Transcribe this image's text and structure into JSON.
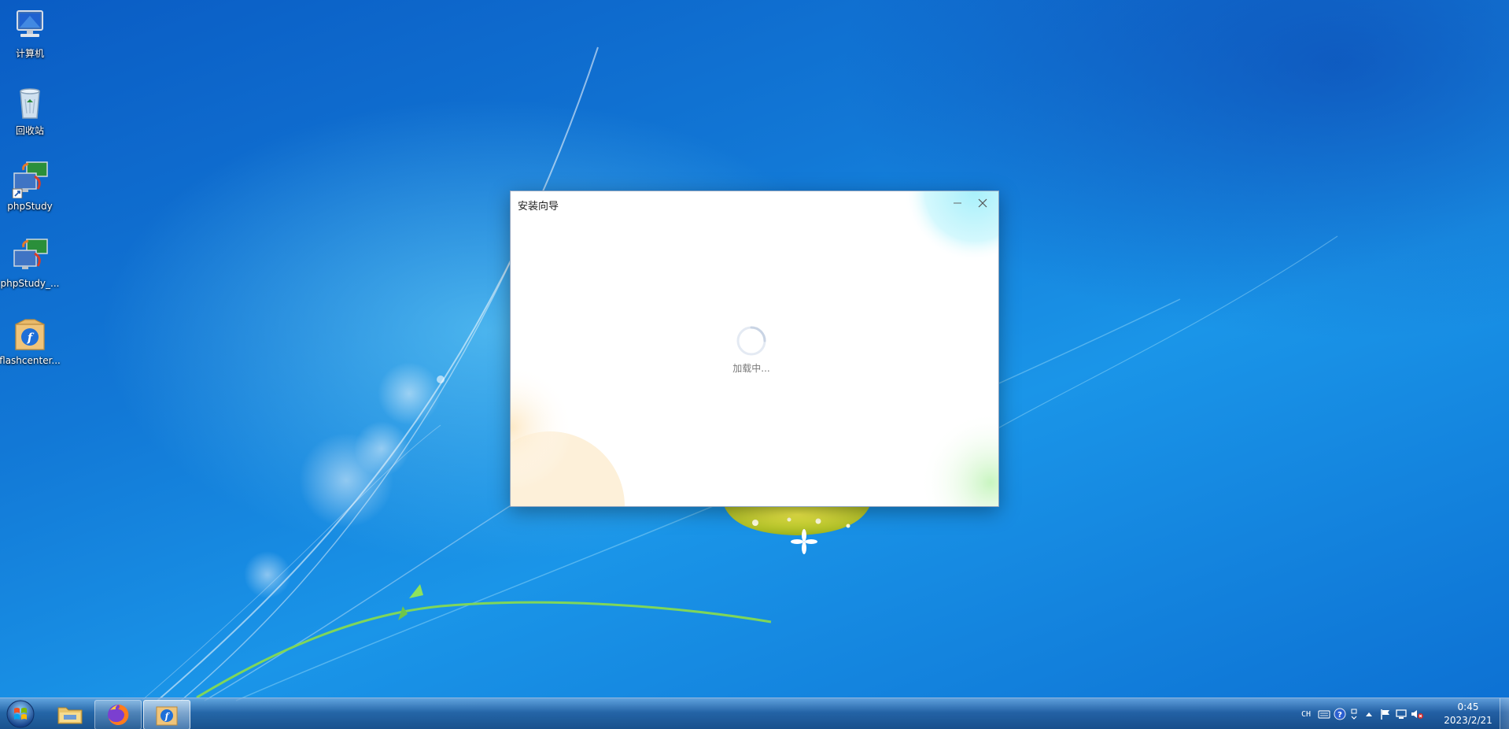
{
  "desktop": {
    "icons": [
      {
        "label": "计算机",
        "icon": "computer-icon"
      },
      {
        "label": "回收站",
        "icon": "recycle-bin-icon"
      },
      {
        "label": "phpStudy",
        "icon": "phpstudy-shortcut-icon"
      },
      {
        "label": "phpStudy_...",
        "icon": "phpstudy-icon"
      },
      {
        "label": "flashcenter...",
        "icon": "flashcenter-installer-icon"
      }
    ]
  },
  "installer": {
    "title": "安装向导",
    "loading_text": "加载中...",
    "minimize_icon": "minimize-icon",
    "close_icon": "close-icon"
  },
  "taskbar": {
    "start_icon": "windows-start-icon",
    "pinned": [
      {
        "name": "explorer",
        "icon": "folder-icon"
      },
      {
        "name": "firefox",
        "icon": "firefox-icon",
        "open": true
      },
      {
        "name": "flashcenter",
        "icon": "flashcenter-icon",
        "active": true
      }
    ],
    "tray": {
      "language": "CH",
      "icons": [
        "keyboard-icon",
        "help-icon",
        "ime-icon",
        "show-hidden-icons-arrow",
        "action-center-flag-icon",
        "network-icon",
        "volume-muted-icon"
      ]
    },
    "clock": {
      "time": "0:45",
      "date": "2023/2/21"
    }
  },
  "colors": {
    "desktop_blue": "#1278d6",
    "taskbar": "#285a96",
    "flash_blue": "#1f6fd8",
    "folder_tan": "#e8b96a"
  }
}
